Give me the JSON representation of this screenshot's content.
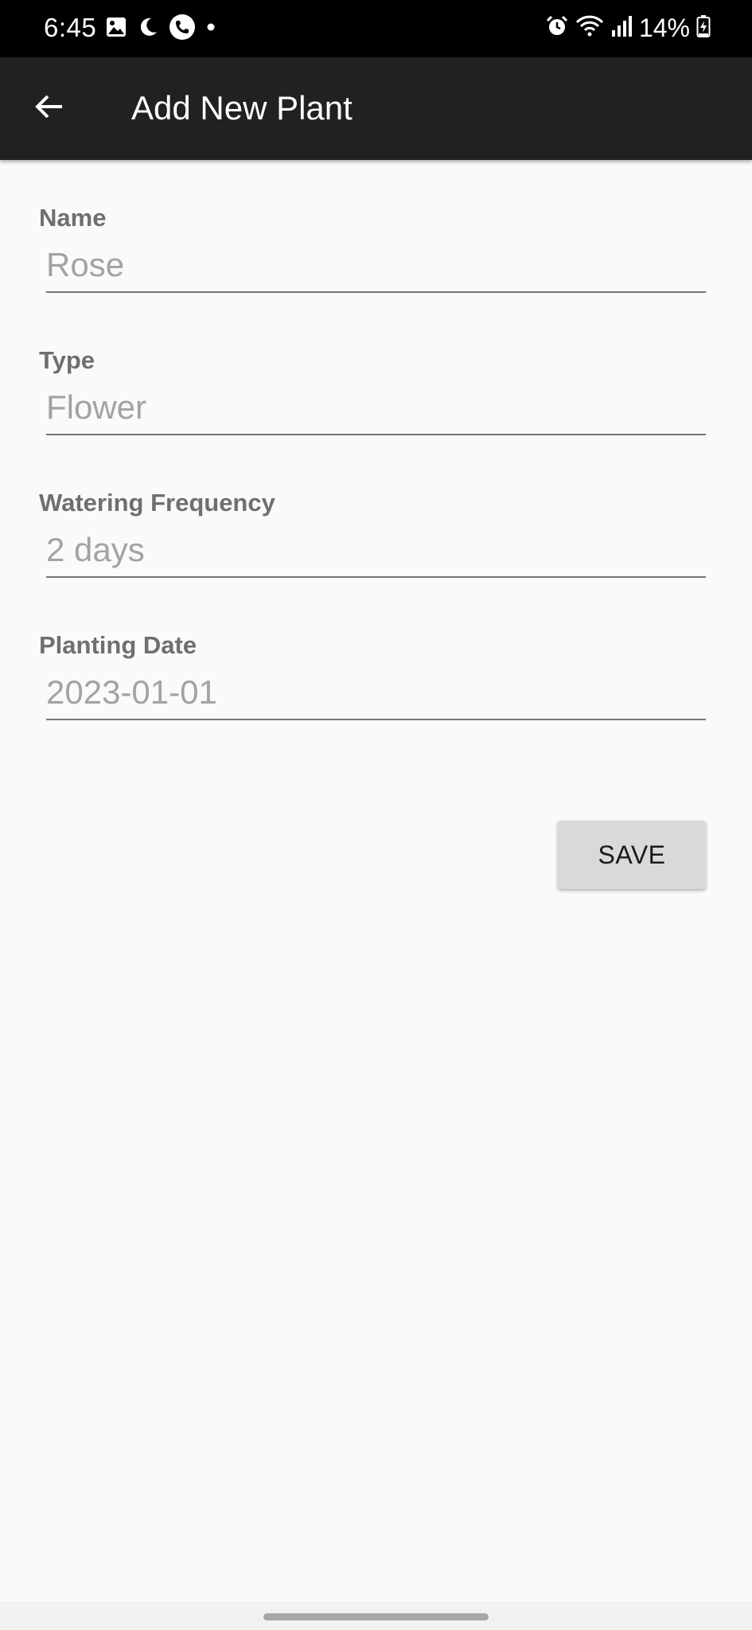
{
  "status_bar": {
    "time": "6:45",
    "left_icons": [
      "gallery-icon",
      "moon-icon",
      "phone-icon",
      "dot-icon"
    ],
    "right_icons": [
      "alarm-icon",
      "wifi-icon",
      "signal-icon",
      "battery-charging-icon"
    ],
    "battery_text": "14%"
  },
  "app_bar": {
    "back_icon": "arrow-back-icon",
    "title": "Add New Plant",
    "background": "#212121"
  },
  "form": {
    "fields": [
      {
        "label": "Name",
        "placeholder": "Rose",
        "value": ""
      },
      {
        "label": "Type",
        "placeholder": "Flower",
        "value": ""
      },
      {
        "label": "Watering Frequency",
        "placeholder": "2 days",
        "value": ""
      },
      {
        "label": "Planting Date",
        "placeholder": "2023-01-01",
        "value": ""
      }
    ],
    "save_label": "SAVE"
  },
  "nav_bar": {
    "handle_icon": "gesture-handle"
  }
}
